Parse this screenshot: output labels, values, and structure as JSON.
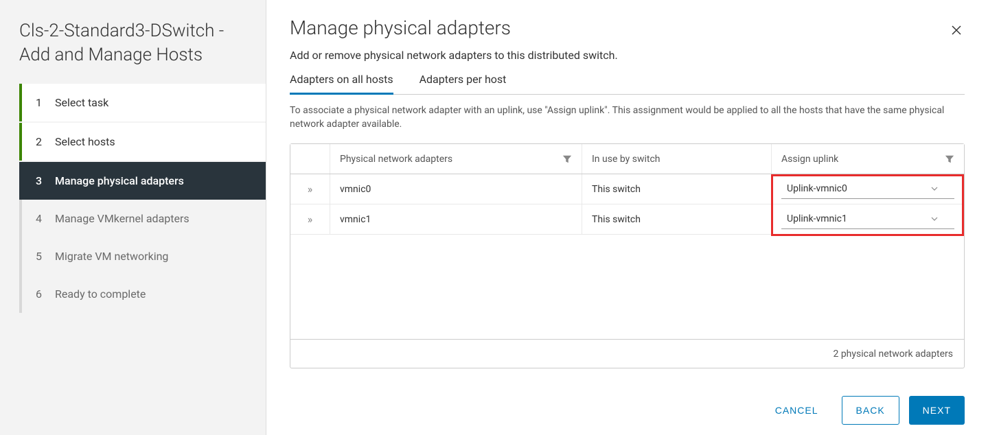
{
  "sidebar": {
    "title": "Cls-2-Standard3-DSwitch - Add and Manage Hosts",
    "steps": [
      {
        "num": "1",
        "label": "Select task",
        "state": "completed"
      },
      {
        "num": "2",
        "label": "Select hosts",
        "state": "completed"
      },
      {
        "num": "3",
        "label": "Manage physical adapters",
        "state": "active"
      },
      {
        "num": "4",
        "label": "Manage VMkernel adapters",
        "state": "pending"
      },
      {
        "num": "5",
        "label": "Migrate VM networking",
        "state": "pending"
      },
      {
        "num": "6",
        "label": "Ready to complete",
        "state": "pending"
      }
    ]
  },
  "main": {
    "title": "Manage physical adapters",
    "subtitle": "Add or remove physical network adapters to this distributed switch.",
    "tabs": [
      {
        "label": "Adapters on all hosts",
        "active": true
      },
      {
        "label": "Adapters per host",
        "active": false
      }
    ],
    "tab_desc": "To associate a physical network adapter with an uplink, use \"Assign uplink\". This assignment would be applied to all the hosts that have the same physical network adapter available.",
    "grid": {
      "headers": {
        "adapter": "Physical network adapters",
        "switch": "In use by switch",
        "uplink": "Assign uplink"
      },
      "rows": [
        {
          "adapter": "vmnic0",
          "switch": "This switch",
          "uplink": "Uplink-vmnic0"
        },
        {
          "adapter": "vmnic1",
          "switch": "This switch",
          "uplink": "Uplink-vmnic1"
        }
      ],
      "footer": "2 physical network adapters"
    },
    "buttons": {
      "cancel": "CANCEL",
      "back": "BACK",
      "next": "NEXT"
    }
  }
}
